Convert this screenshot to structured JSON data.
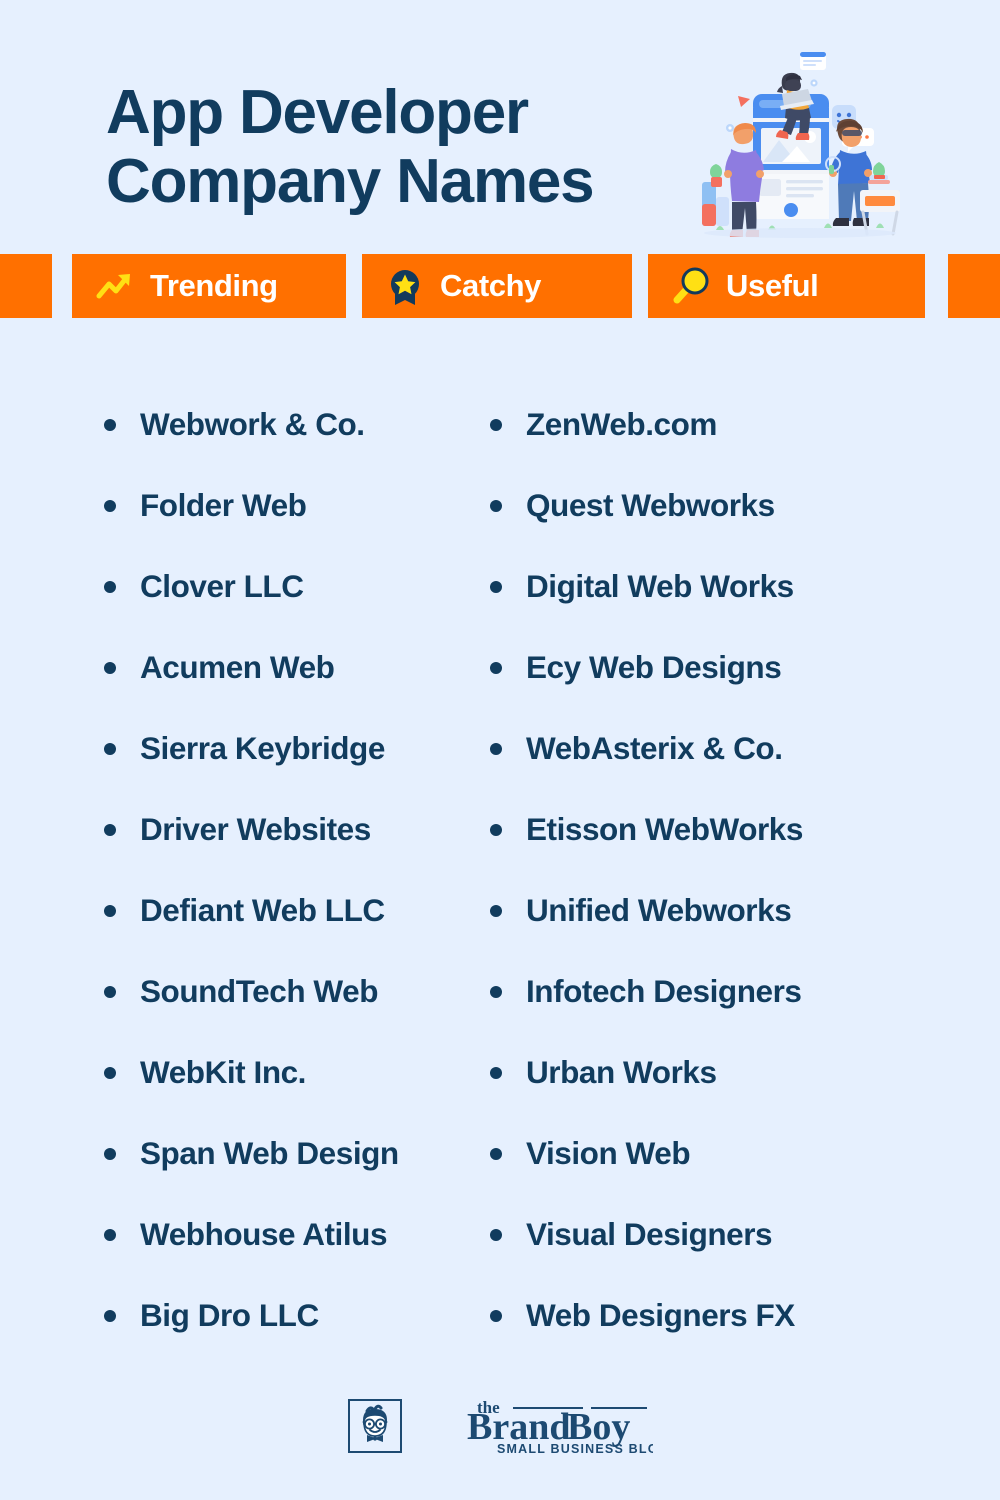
{
  "page": {
    "background_color": "#e6f0fe",
    "accent_orange": "#ff7000",
    "text_navy": "#113c5e",
    "icon_yellow": "#ffd400"
  },
  "header": {
    "title_line1": "App Developer",
    "title_line2": "Company Names",
    "illustration_name": "app-development-team-illustration"
  },
  "badges": [
    {
      "label": "Trending",
      "icon": "trending-up-icon"
    },
    {
      "label": "Catchy",
      "icon": "award-ribbon-star-icon"
    },
    {
      "label": "Useful",
      "icon": "magnifying-glass-icon"
    }
  ],
  "lists": {
    "left_column": [
      "Webwork & Co.",
      "Folder Web",
      "Clover LLC",
      "Acumen Web",
      "Sierra Keybridge",
      "Driver Websites",
      "Defiant Web LLC",
      "SoundTech Web",
      "WebKit Inc.",
      "Span Web Design",
      "Webhouse Atilus",
      "Big Dro LLC"
    ],
    "right_column": [
      "ZenWeb.com",
      "Quest Webworks",
      "Digital Web Works",
      "Ecy Web Designs",
      "WebAsterix & Co.",
      "Etisson WebWorks",
      "Unified Webworks",
      "Infotech Designers",
      "Urban Works",
      "Vision Web",
      "Visual Designers",
      "Web Designers FX"
    ]
  },
  "footer": {
    "logo_the": "the",
    "logo_brand": "Brand",
    "logo_boy": "Boy",
    "logo_tagline": "SMALL BUSINESS BLOG",
    "logo_mark_name": "brandboy-face-icon"
  }
}
